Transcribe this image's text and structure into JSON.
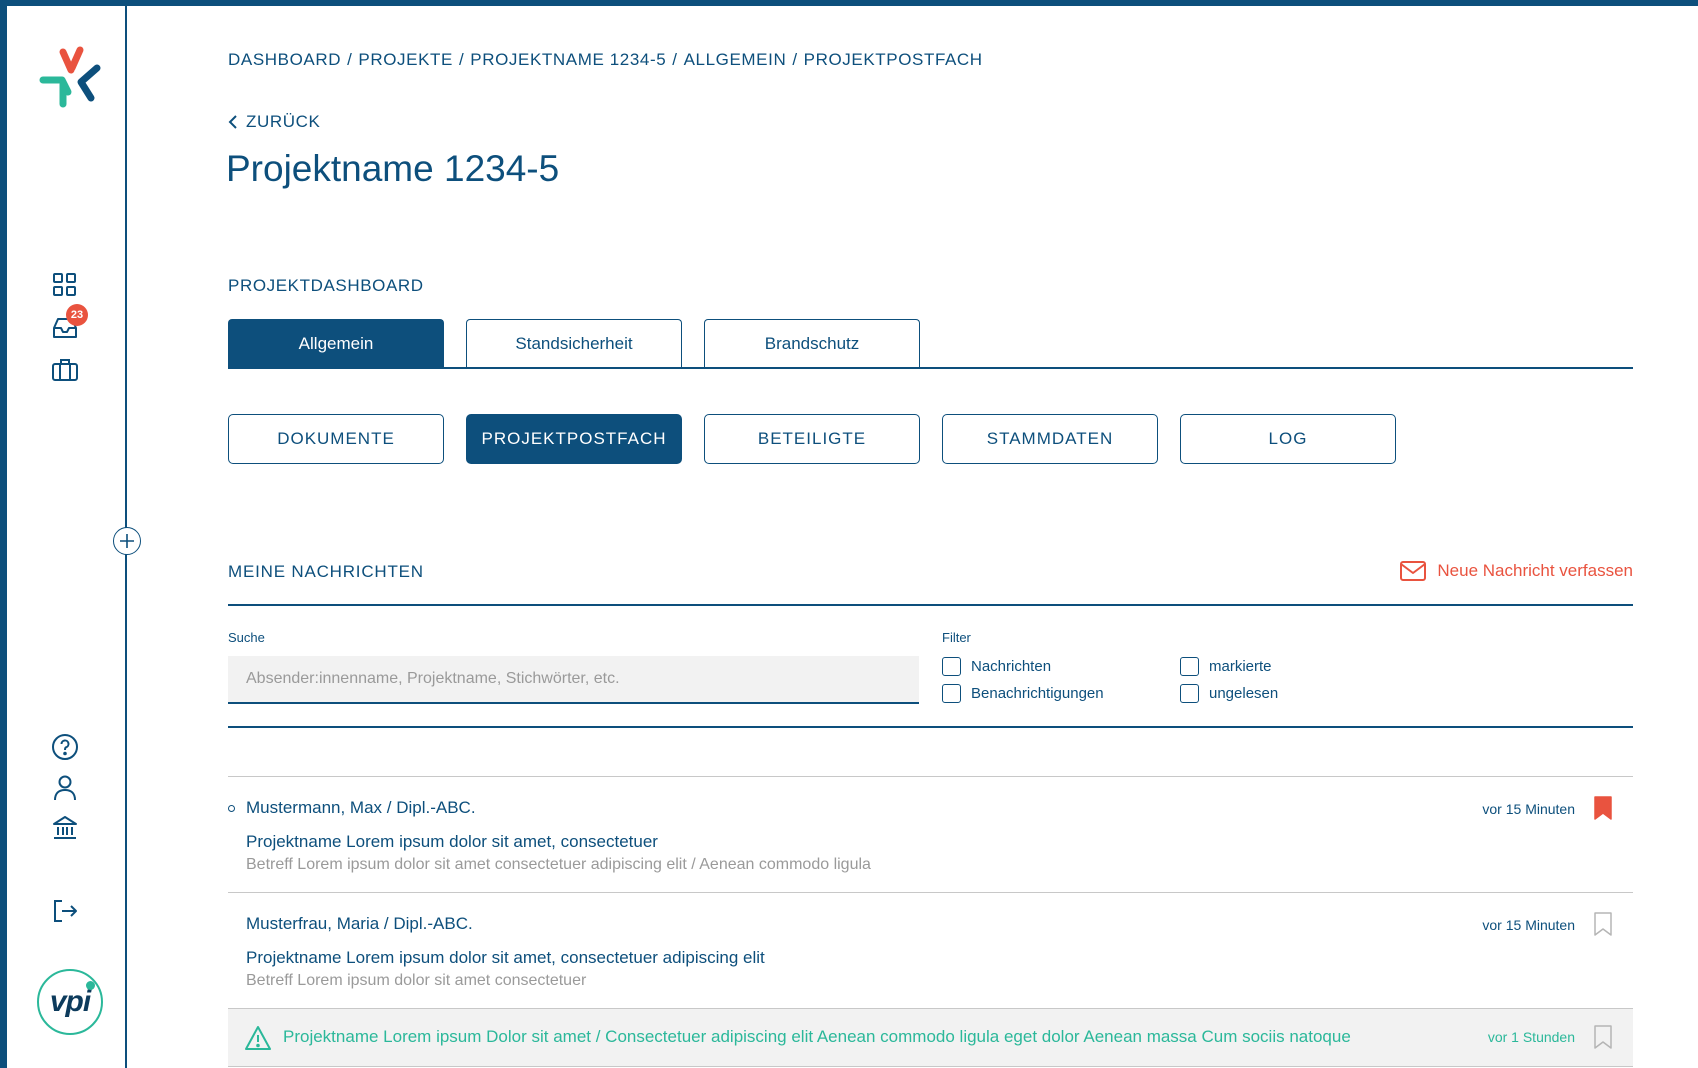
{
  "breadcrumb": {
    "items": [
      "DASHBOARD",
      "PROJEKTE",
      "PROJEKTNAME 1234-5",
      "ALLGEMEIN",
      "PROJEKTPOSTFACH"
    ],
    "separator": "/"
  },
  "back_label": "ZURÜCK",
  "page_title": "Projektname 1234-5",
  "sidebar": {
    "inbox_badge": "23"
  },
  "dashboard": {
    "label": "PROJEKTDASHBOARD",
    "tabs": [
      "Allgemein",
      "Standsicherheit",
      "Brandschutz"
    ],
    "active_tab": "Allgemein"
  },
  "subnav": {
    "items": [
      "DOKUMENTE",
      "PROJEKTPOSTFACH",
      "BETEILIGTE",
      "STAMMDATEN",
      "LOG"
    ],
    "active": "PROJEKTPOSTFACH"
  },
  "messages": {
    "title": "MEINE NACHRICHTEN",
    "new_message_label": "Neue Nachricht verfassen",
    "search_label": "Suche",
    "search_placeholder": "Absender:innenname, Projektname, Stichwörter, etc.",
    "filter_label": "Filter",
    "filters": [
      "Nachrichten",
      "Benachrichtigungen",
      "markierte",
      "ungelesen"
    ],
    "rows": [
      {
        "sender": "Mustermann, Max / Dipl.-ABC.",
        "project": "Projektname Lorem ipsum dolor sit amet, consectetuer",
        "subject": "Betreff Lorem ipsum dolor sit amet consectetuer adipiscing elit / Aenean commodo ligula",
        "time": "vor 15 Minuten",
        "unread": true,
        "bookmarked": true
      },
      {
        "sender": "Musterfrau, Maria / Dipl.-ABC.",
        "project": "Projektname Lorem ipsum dolor sit amet, consectetuer adipiscing elit",
        "subject": "Betreff Lorem ipsum dolor sit amet consectetuer",
        "time": "vor 15 Minuten",
        "unread": false,
        "bookmarked": false
      }
    ],
    "notification": {
      "text": "Projektname Lorem ipsum Dolor sit amet / Consectetuer adipiscing elit Aenean commodo ligula eget dolor Aenean massa Cum sociis natoque",
      "time": "vor 1 Stunden",
      "bookmarked": false
    }
  },
  "colors": {
    "primary": "#0d4f7c",
    "accent_red": "#e9533f",
    "accent_green": "#2bb89a",
    "muted_text": "#9a9a9a",
    "search_bg": "#f2f2f2"
  }
}
